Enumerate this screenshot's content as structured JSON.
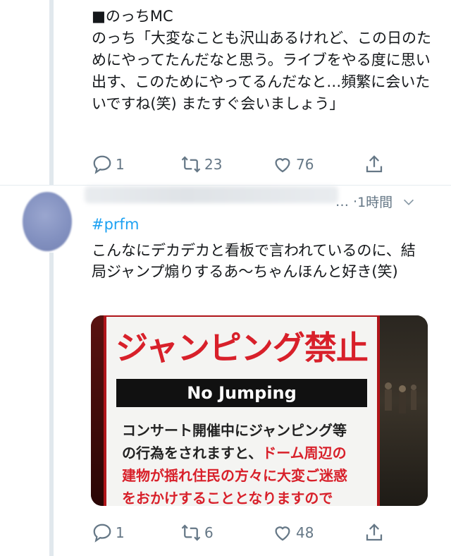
{
  "tweet1": {
    "text": "■のっちMC\nのっち「大変なことも沢山あるけれど、この日のためにやってたんだなと思う。ライブをやる度に思い出す、このためにやってるんだなと…頻繁に会いたいですね(笑) またすぐ会いましょう」",
    "reply_count": "1",
    "retweet_count": "23",
    "like_count": "76"
  },
  "tweet2": {
    "time": "1時間",
    "hashtag": "#prfm",
    "text": "こんなにデカデカと看板で言われているのに、結局ジャンプ煽りするあ〜ちゃんほんと好き(笑)",
    "reply_count": "1",
    "retweet_count": "6",
    "like_count": "48",
    "image": {
      "title": "ジャンピング禁止",
      "band": "No Jumping",
      "body_normal_1": "コンサート開催中にジャンピング等",
      "body_normal_2": "の行為をされますと、",
      "body_red_1": "ドーム周辺の",
      "body_red_2": "建物が揺れ住民の方々に大変ご迷惑",
      "body_red_3": "をおかけすることとなりますので"
    }
  },
  "colors": {
    "icon_gray": "#657786",
    "link_blue": "#1da1f2",
    "sign_red": "#d8202a"
  },
  "icons": [
    "reply-icon",
    "retweet-icon",
    "like-icon",
    "share-icon",
    "chevron-down-icon"
  ]
}
